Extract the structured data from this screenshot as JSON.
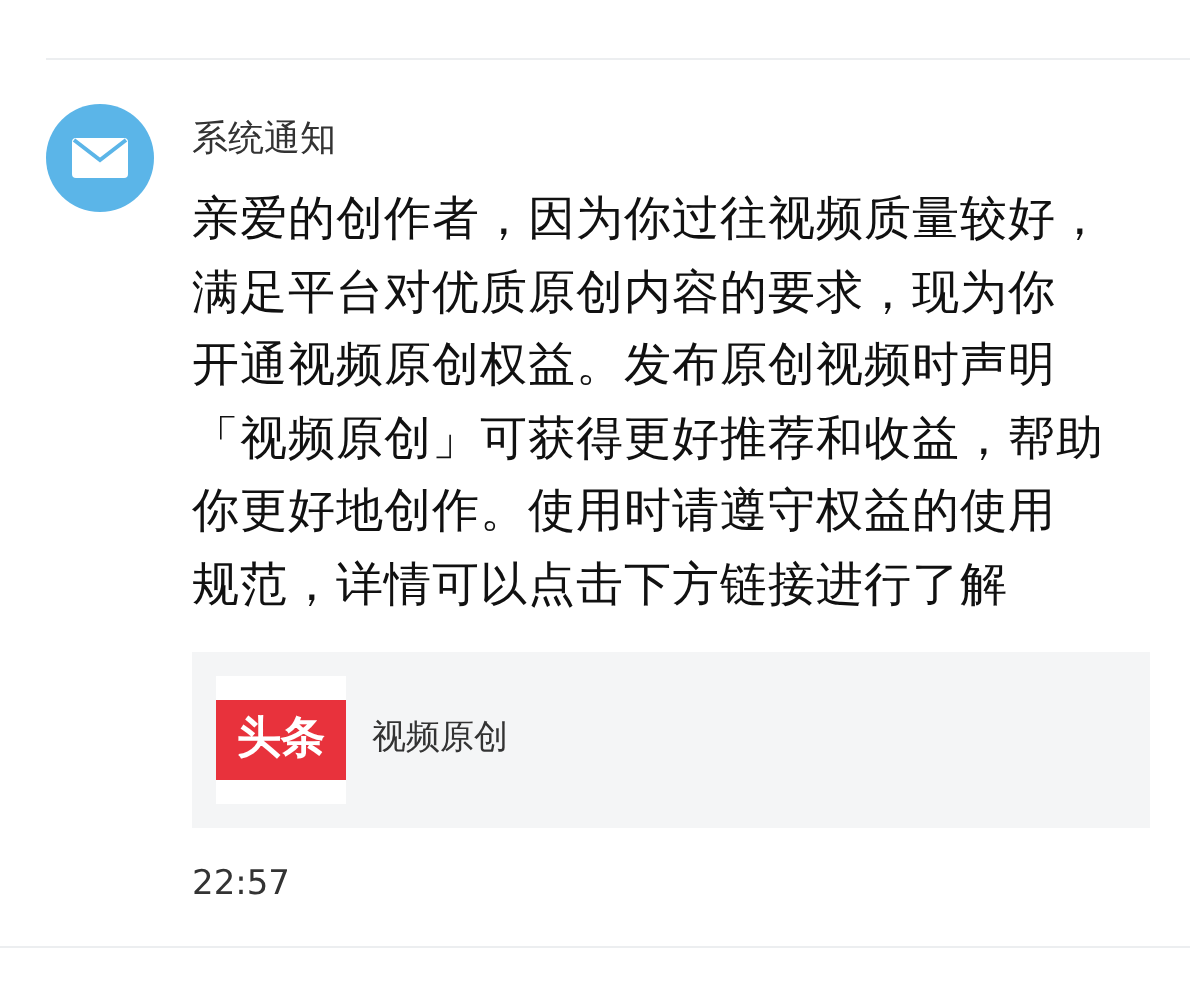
{
  "notification": {
    "sender": "系统通知",
    "message_lines": [
      "亲爱的创作者，因为你过往视频质量较好，",
      "满足平台对优质原创内容的要求，现为你",
      "开通视频原创权益。发布原创视频时声明",
      "「视频原创」可获得更好推荐和收益，帮助",
      "你更好地创作。使用时请遵守权益的使用",
      "规范，详情可以点击下方链接进行了解"
    ],
    "link_card": {
      "logo_text": "头条",
      "title": "视频原创"
    },
    "time": "22:57"
  }
}
